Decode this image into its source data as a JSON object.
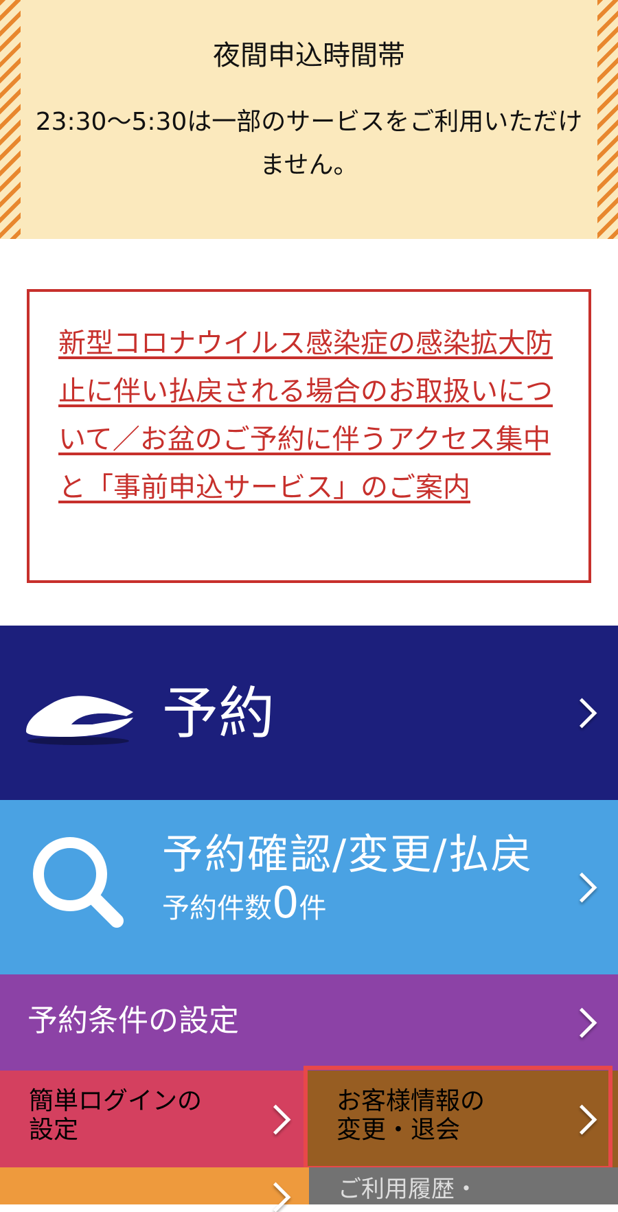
{
  "night_notice": {
    "title": "夜間申込時間帯",
    "body": "23:30〜5:30は一部のサービスをご利用いただけません。"
  },
  "covid_notice": {
    "link_text": "新型コロナウイルス感染症の感染拡大防止に伴い払戻される場合のお取扱いについて／お盆のご予約に伴うアクセス集中と「事前申込サービス」のご案内"
  },
  "menu": {
    "reserve": {
      "label": "予約",
      "icon": "shinkansen-train-icon"
    },
    "confirm": {
      "label": "予約確認/変更/払戻",
      "count_prefix": "予約件数",
      "count": "0",
      "count_suffix": "件",
      "icon": "search-icon"
    },
    "conditions": {
      "label": "予約条件の設定"
    },
    "easy_login": {
      "label_line1": "簡単ログインの",
      "label_line2": "設定"
    },
    "customer_info": {
      "label_line1": "お客様情報の",
      "label_line2": "変更・退会"
    },
    "history": {
      "label": "ご利用履歴・"
    }
  },
  "colors": {
    "reserve": "#1c1f7c",
    "confirm": "#4aa2e3",
    "conditions": "#8c42a6",
    "easy_login": "#d4405f",
    "customer_info": "#975d22",
    "highlight_frame": "#e8484a",
    "notice_red": "#c7302c",
    "night_bg": "#fbe9bd"
  }
}
